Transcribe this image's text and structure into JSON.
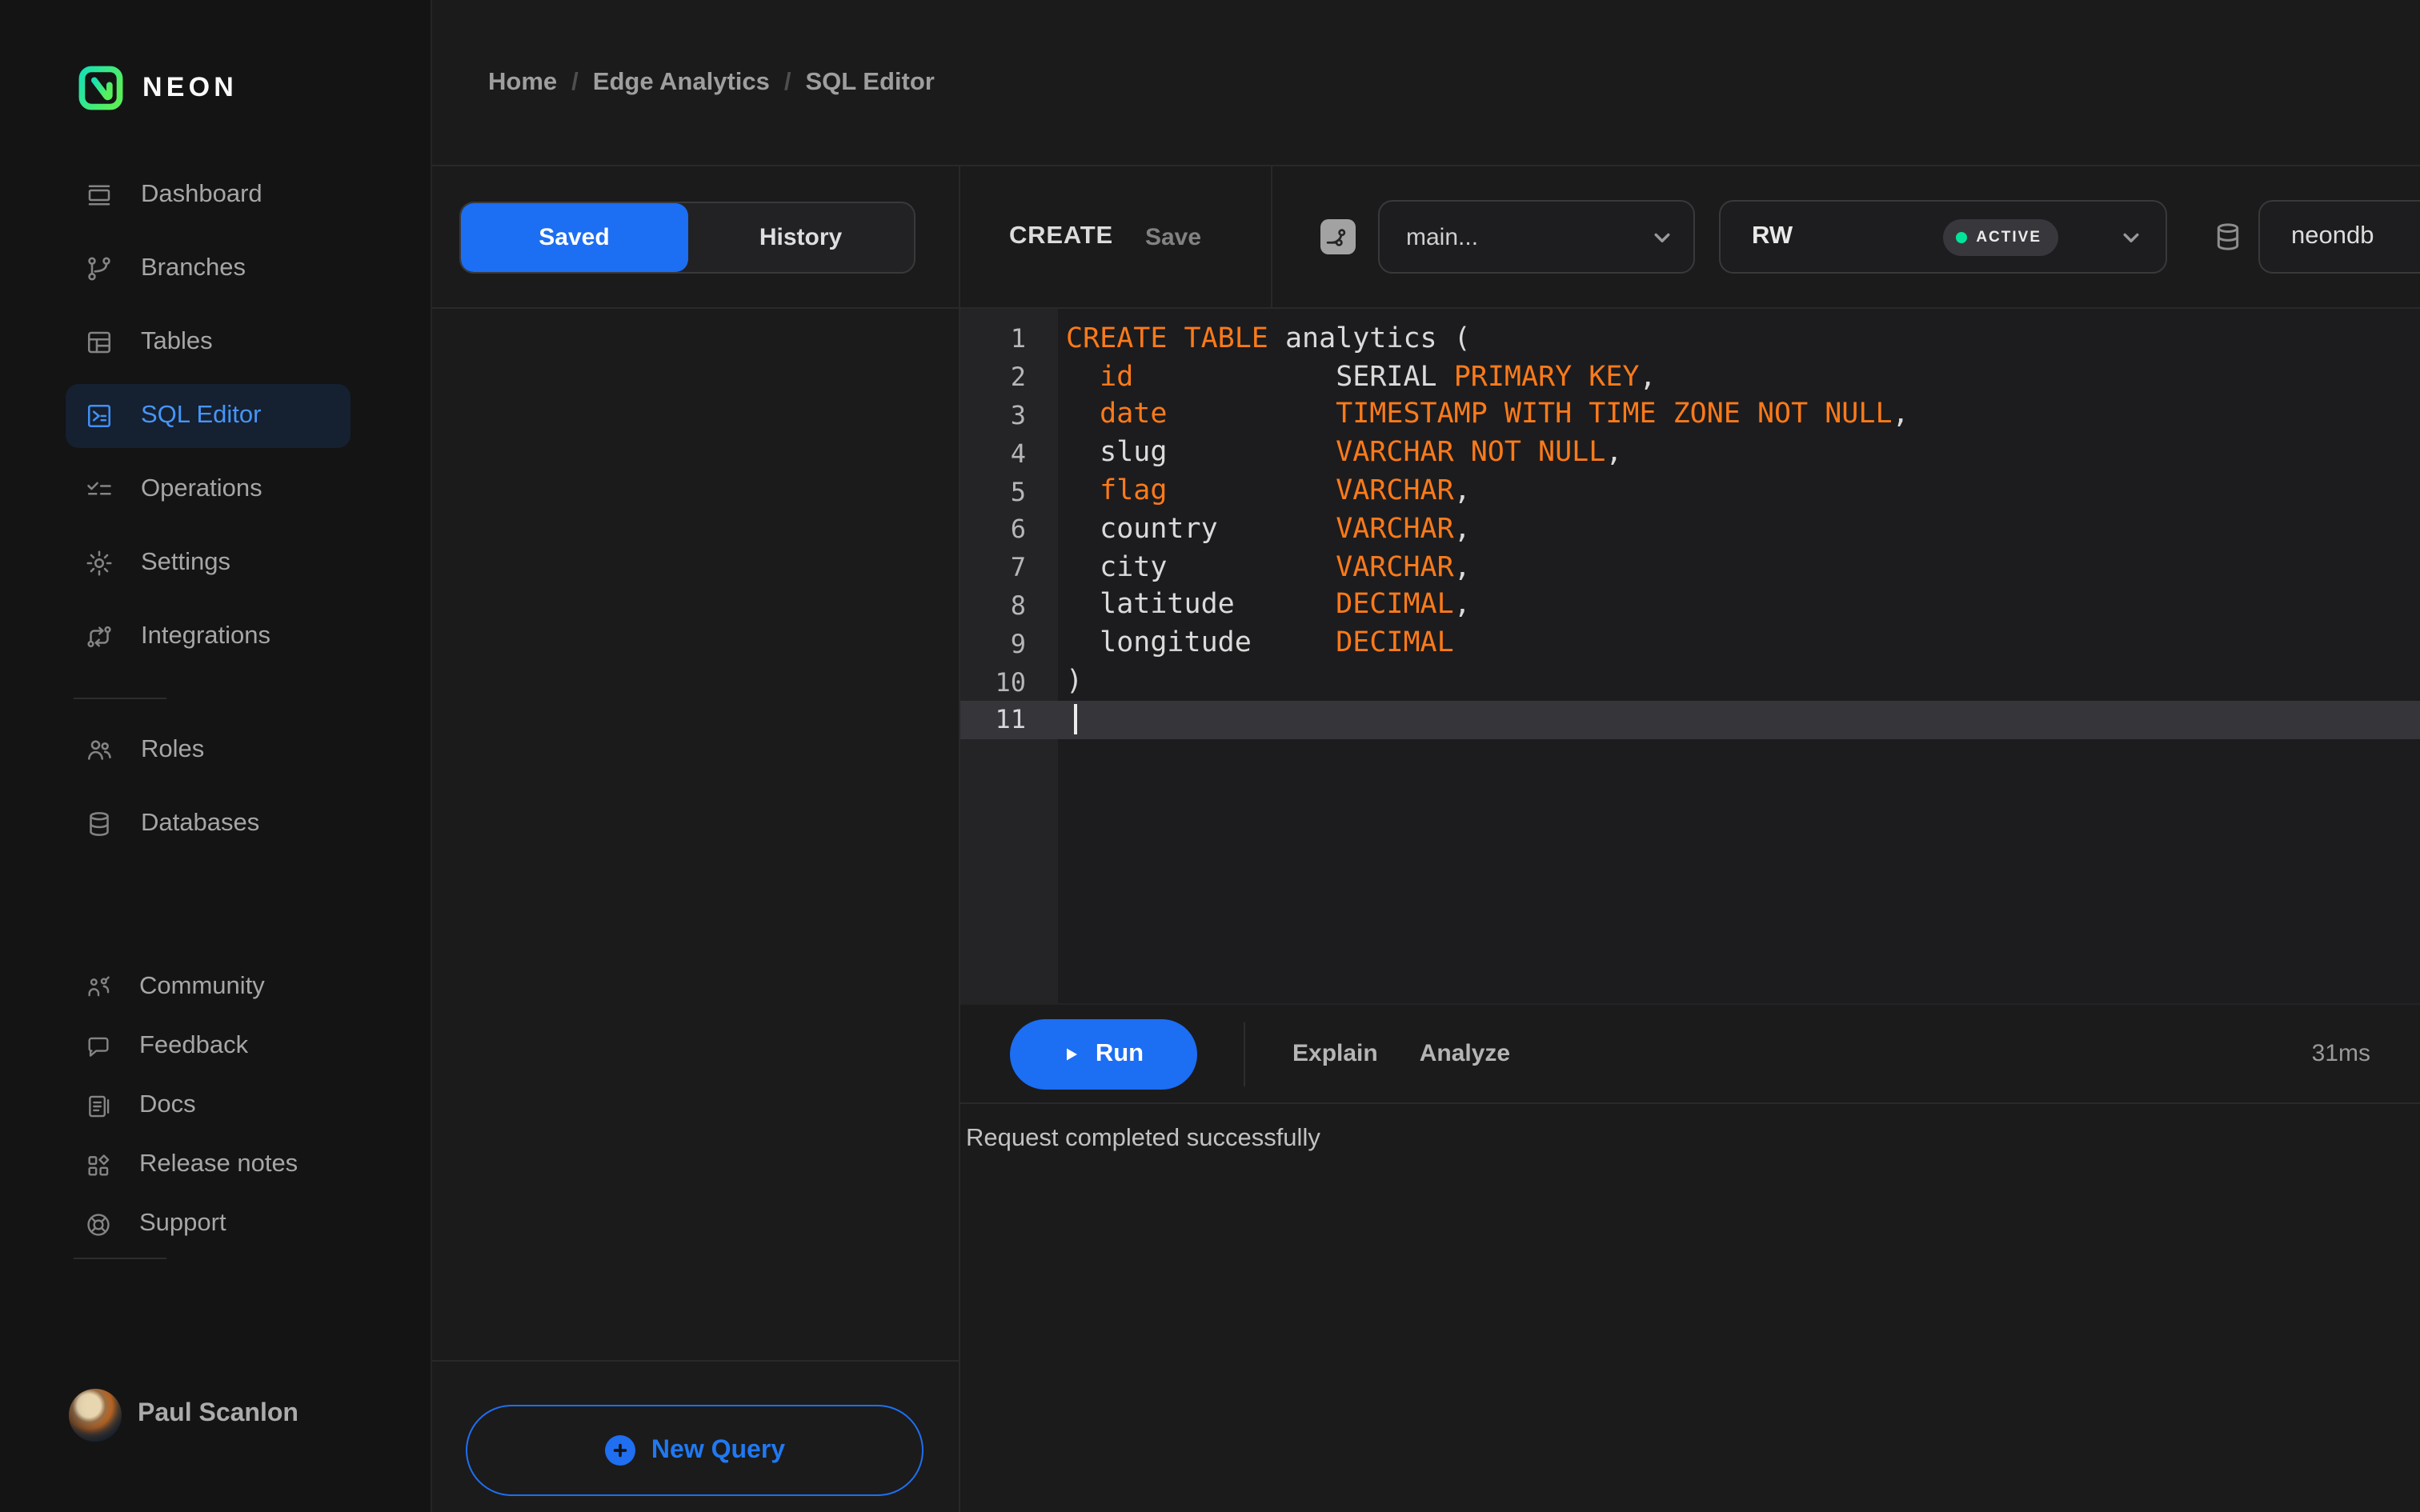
{
  "colors": {
    "accent_blue": "#1c6ef3",
    "sidebar_active_blue": "#4695f8",
    "code_orange": "#fb7a1a",
    "neon_green": "#00e599"
  },
  "sidebar": {
    "logo_text": "NEON",
    "top_items": [
      {
        "icon": "dashboard-icon",
        "label": "Dashboard",
        "active": false
      },
      {
        "icon": "branches-icon",
        "label": "Branches",
        "active": false
      },
      {
        "icon": "tables-icon",
        "label": "Tables",
        "active": false
      },
      {
        "icon": "sql-editor-icon",
        "label": "SQL Editor",
        "active": true
      },
      {
        "icon": "operations-icon",
        "label": "Operations",
        "active": false
      },
      {
        "icon": "settings-icon",
        "label": "Settings",
        "active": false
      },
      {
        "icon": "integrations-icon",
        "label": "Integrations",
        "active": false
      }
    ],
    "mid_items": [
      {
        "icon": "roles-icon",
        "label": "Roles",
        "active": false
      },
      {
        "icon": "databases-icon",
        "label": "Databases",
        "active": false
      }
    ],
    "bottom_items": [
      {
        "icon": "community-icon",
        "label": "Community",
        "active": false
      },
      {
        "icon": "feedback-icon",
        "label": "Feedback",
        "active": false
      },
      {
        "icon": "docs-icon",
        "label": "Docs",
        "active": false
      },
      {
        "icon": "release-notes-icon",
        "label": "Release notes",
        "active": false
      },
      {
        "icon": "support-icon",
        "label": "Support",
        "active": false
      }
    ],
    "user": {
      "name": "Paul Scanlon"
    }
  },
  "breadcrumb": {
    "separator": "/",
    "items": [
      "Home",
      "Edge Analytics",
      "SQL Editor"
    ]
  },
  "saved_panel": {
    "tabs": [
      {
        "label": "Saved",
        "active": true
      },
      {
        "label": "History",
        "active": false
      }
    ],
    "new_query_label": "New Query"
  },
  "editor": {
    "title": "CREATE",
    "save_label": "Save",
    "branch_select": {
      "value": "main..."
    },
    "compute_select": {
      "value": "RW",
      "status": "ACTIVE"
    },
    "database_select": {
      "value": "neondb"
    },
    "code_lines": [
      {
        "num": "1",
        "active": false,
        "tokens": [
          [
            "CREATE TABLE",
            "kw"
          ],
          [
            " analytics (",
            "pl"
          ]
        ]
      },
      {
        "num": "2",
        "active": false,
        "tokens": [
          [
            "  id",
            "kw"
          ],
          [
            "            ",
            "pl"
          ],
          [
            "SERIAL ",
            "pl"
          ],
          [
            "PRIMARY KEY",
            "kw"
          ],
          [
            ",",
            "pl"
          ]
        ]
      },
      {
        "num": "3",
        "active": false,
        "tokens": [
          [
            "  date",
            "kw"
          ],
          [
            "          ",
            "pl"
          ],
          [
            "TIMESTAMP WITH TIME ZONE NOT NULL",
            "kw"
          ],
          [
            ",",
            "pl"
          ]
        ]
      },
      {
        "num": "4",
        "active": false,
        "tokens": [
          [
            "  slug",
            "pl"
          ],
          [
            "          ",
            "pl"
          ],
          [
            "VARCHAR NOT NULL",
            "kw"
          ],
          [
            ",",
            "pl"
          ]
        ]
      },
      {
        "num": "5",
        "active": false,
        "tokens": [
          [
            "  flag",
            "kw"
          ],
          [
            "          ",
            "pl"
          ],
          [
            "VARCHAR",
            "kw"
          ],
          [
            ",",
            "pl"
          ]
        ]
      },
      {
        "num": "6",
        "active": false,
        "tokens": [
          [
            "  country",
            "pl"
          ],
          [
            "       ",
            "pl"
          ],
          [
            "VARCHAR",
            "kw"
          ],
          [
            ",",
            "pl"
          ]
        ]
      },
      {
        "num": "7",
        "active": false,
        "tokens": [
          [
            "  city",
            "pl"
          ],
          [
            "          ",
            "pl"
          ],
          [
            "VARCHAR",
            "kw"
          ],
          [
            ",",
            "pl"
          ]
        ]
      },
      {
        "num": "8",
        "active": false,
        "tokens": [
          [
            "  latitude",
            "pl"
          ],
          [
            "      ",
            "pl"
          ],
          [
            "DECIMAL",
            "kw"
          ],
          [
            ",",
            "pl"
          ]
        ]
      },
      {
        "num": "9",
        "active": false,
        "tokens": [
          [
            "  longitude",
            "pl"
          ],
          [
            "     ",
            "pl"
          ],
          [
            "DECIMAL",
            "kw"
          ]
        ]
      },
      {
        "num": "10",
        "active": false,
        "tokens": [
          [
            ")",
            "pl"
          ]
        ]
      },
      {
        "num": "11",
        "active": true,
        "tokens": []
      }
    ],
    "run_label": "Run",
    "explain_label": "Explain",
    "analyze_label": "Analyze",
    "duration": "31ms",
    "result_message": "Request completed successfully"
  }
}
